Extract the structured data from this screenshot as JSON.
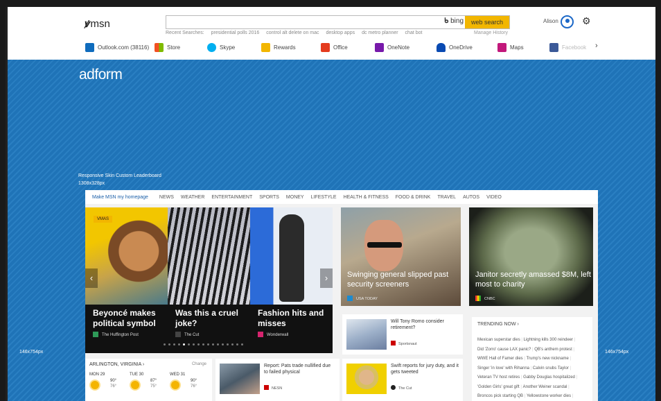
{
  "header": {
    "logo": "msn",
    "search_placeholder": "",
    "bing": "bing",
    "search_button": "web search",
    "recent_label": "Recent Searches:",
    "recent": [
      "presidential polls 2016",
      "control alt delete on mac",
      "desktop apps",
      "dc metro planner",
      "chat bot"
    ],
    "manage_history": "Manage History",
    "user_name": "Alison"
  },
  "apps": [
    {
      "label": "Outlook.com (38116)",
      "color": "#0f6cbd"
    },
    {
      "label": "Store",
      "color": "#f25022"
    },
    {
      "label": "Skype",
      "color": "#00aff0"
    },
    {
      "label": "Rewards",
      "color": "#f2b600"
    },
    {
      "label": "Office",
      "color": "#e43b1e"
    },
    {
      "label": "OneNote",
      "color": "#7719aa"
    },
    {
      "label": "OneDrive",
      "color": "#094ab2"
    },
    {
      "label": "Maps",
      "color": "#c2187b"
    },
    {
      "label": "Facebook",
      "color": "#3b5998"
    }
  ],
  "ad": {
    "brand": "adform",
    "line1": "Responsive Skin Custom Leaderboard",
    "line2": "1308x328px",
    "side_left": "146x754px",
    "side_right": "146x754px",
    "color": "#1f73b7"
  },
  "nav": {
    "make_homepage": "Make MSN my homepage",
    "items": [
      "NEWS",
      "WEATHER",
      "ENTERTAINMENT",
      "SPORTS",
      "MONEY",
      "LIFESTYLE",
      "HEALTH & FITNESS",
      "FOOD & DRINK",
      "TRAVEL",
      "AUTOS",
      "VIDEO"
    ]
  },
  "carousel": {
    "badge": "VMAS",
    "slides": [
      {
        "caption": "Beyoncé makes political symbol",
        "source": "The Huffington Post",
        "src_color": "#2e9a58"
      },
      {
        "caption": "Was this a cruel joke?",
        "source": "The Cut",
        "src_color": "#222222"
      },
      {
        "caption": "Fashion hits and misses",
        "source": "Wonderwall",
        "src_color": "#d6246e"
      }
    ],
    "prev": "‹",
    "next": "›"
  },
  "cards": [
    {
      "caption": "Swinging general slipped past security screeners",
      "source": "USA TODAY",
      "src_color": "#1c8bd0"
    },
    {
      "caption": "Janitor secretly amassed $8M, left most to charity",
      "source": "CNBC",
      "src_color": "#ffffff"
    }
  ],
  "small_cards": [
    {
      "title": "Will Tony Romo consider retirement?",
      "source": "Sportsnaut"
    },
    {
      "title": "Report: Pats trade nullified due to failed physical",
      "source": "NESN"
    },
    {
      "title": "Swift reports for jury duty, and it gets tweeted",
      "source": "The Cut"
    }
  ],
  "trending": {
    "header": "TRENDING NOW ›",
    "items": [
      "Mexican superstar dies",
      "Lightning kills 300 reindeer",
      "Did 'Zorro' cause LAX panic?",
      "QB's anthem protest",
      "WWE Hall of Famer dies",
      "Trump's new nickname",
      "Singer 'in love' with Rihanna",
      "Calvin snubs Taylor",
      "Veteran TV host retires",
      "Gabby Douglas hospitalized",
      "'Golden Girls' great gift",
      "Another Weiner scandal",
      "Broncos pick starting QB",
      "Yellowstone worker dies"
    ]
  },
  "weather": {
    "location": "ARLINGTON, VIRGINIA ›",
    "change": "Change",
    "days": [
      {
        "name": "MON 29",
        "hi": "90°",
        "lo": "76°"
      },
      {
        "name": "TUE 30",
        "hi": "87°",
        "lo": "75°"
      },
      {
        "name": "WED 31",
        "hi": "90°",
        "lo": "76°"
      }
    ]
  }
}
